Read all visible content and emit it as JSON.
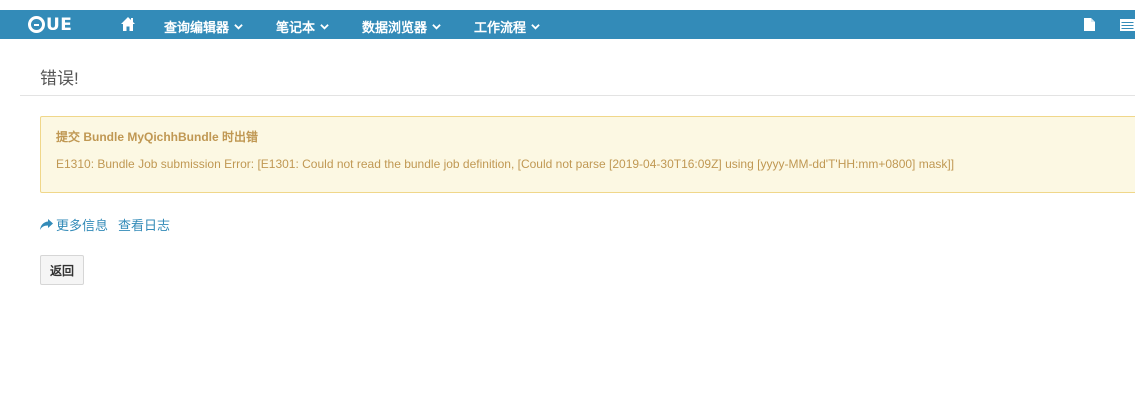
{
  "navbar": {
    "logo_text": "HUE",
    "items": [
      {
        "label": "查询编辑器"
      },
      {
        "label": "笔记本"
      },
      {
        "label": "数据浏览器"
      },
      {
        "label": "工作流程"
      }
    ],
    "background": "#338bb8"
  },
  "page": {
    "title": "错误!"
  },
  "alert": {
    "title": "提交 Bundle MyQichhBundle 时出错",
    "message": "E1310: Bundle Job submission Error: [E1301: Could not read the bundle job definition, [Could not parse [2019-04-30T16:09Z] using [yyyy-MM-dd'T'HH:mm+0800] mask]]",
    "background": "#fcf8e3",
    "text_color": "#c09853"
  },
  "links": {
    "more_info": "更多信息",
    "view_logs": "查看日志",
    "color": "#338bb8"
  },
  "buttons": {
    "back": "返回"
  },
  "icons": [
    "hue-logo",
    "home-icon",
    "chevron-down-icon",
    "document-icon",
    "grid-icon",
    "share-icon"
  ]
}
